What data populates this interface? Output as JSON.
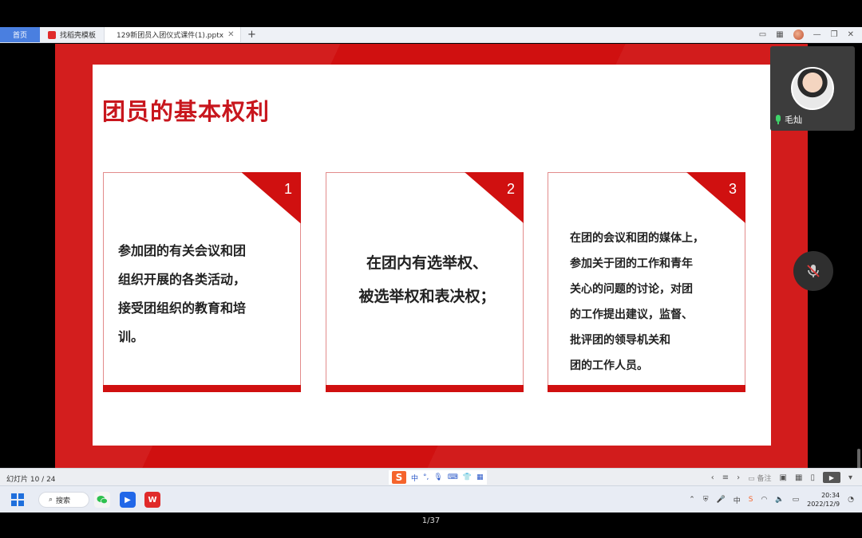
{
  "tabs": {
    "home": "首页",
    "template": "找稻壳模板",
    "document": "129新团员入团仪式课件(1).pptx"
  },
  "slide": {
    "title": "团员的基本权利",
    "cards": [
      {
        "number": "1",
        "lines": [
          "参加团的有关会议和团",
          "组织开展的各类活动，",
          "接受团组织的教育和培",
          "训。"
        ]
      },
      {
        "number": "2",
        "lines": [
          "在团内有选举权、",
          "被选举权和表决权；"
        ]
      },
      {
        "number": "3",
        "lines": [
          "在团的会议和团的媒体上，",
          "参加关于团的工作和青年",
          "关心的问题的讨论，对团",
          "的工作提出建议，监督、",
          "批评团的领导机关和",
          "团的工作人员。"
        ]
      }
    ]
  },
  "participant": {
    "name": "毛灿"
  },
  "statusbar": {
    "slide_count": "幻灯片 10 / 24",
    "ime": {
      "logo": "S",
      "mode": "中",
      "punct": "°,"
    },
    "notes": "备注"
  },
  "taskbar": {
    "search": "搜索",
    "time": "20:34",
    "date": "2022/12/9"
  },
  "page_indicator": "1/37",
  "colors": {
    "brand_red": "#d01010",
    "title_red": "#c8161d",
    "tab_home_blue": "#4a7fe0"
  }
}
